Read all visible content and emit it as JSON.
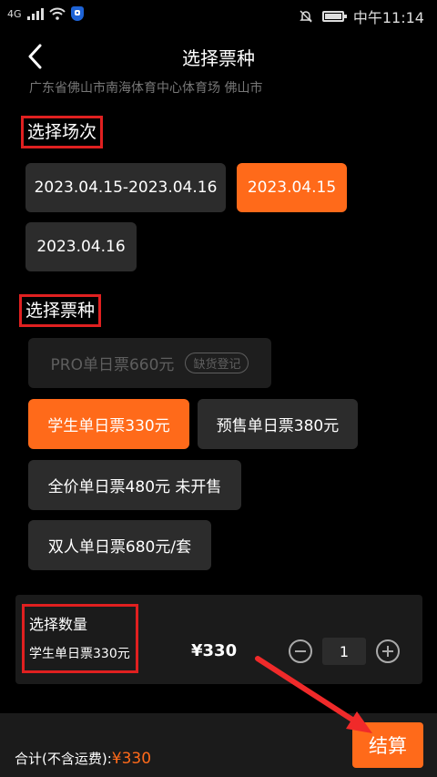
{
  "status_bar": {
    "network": "4G",
    "time": "中午11:14"
  },
  "header": {
    "title": "选择票种"
  },
  "venue": "广东省佛山市南海体育中心体育场 佛山市",
  "sessions": {
    "title": "选择场次",
    "options": [
      "2023.04.15-2023.04.16",
      "2023.04.15",
      "2023.04.16"
    ],
    "selected": "2023.04.15"
  },
  "ticket_types": {
    "title": "选择票种",
    "options": [
      {
        "label": "PRO单日票660元",
        "tag": "缺货登记",
        "state": "disabled"
      },
      {
        "label": "学生单日票330元",
        "state": "selected"
      },
      {
        "label": "预售单日票380元",
        "state": "normal"
      },
      {
        "label": "全价单日票480元 未开售",
        "state": "normal"
      },
      {
        "label": "双人单日票680元/套",
        "state": "normal"
      }
    ]
  },
  "quantity": {
    "title": "选择数量",
    "ticket_name": "学生单日票330元",
    "price": "¥330",
    "value": "1"
  },
  "footer": {
    "total_label": "合计(不含运费):",
    "total_amount": "¥330",
    "checkout_label": "结算"
  },
  "colors": {
    "accent": "#ff6a1a",
    "highlight_box": "#e02020",
    "chip": "#2c2c2c"
  }
}
